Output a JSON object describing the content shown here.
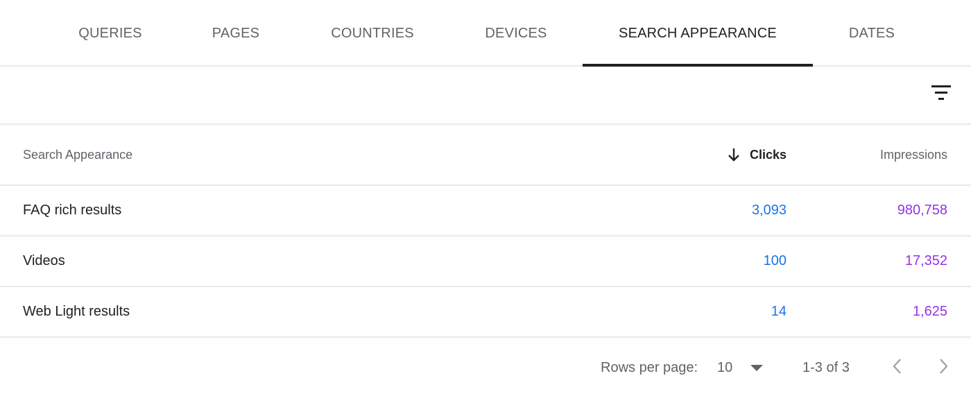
{
  "tabs": [
    {
      "label": "QUERIES",
      "active": false
    },
    {
      "label": "PAGES",
      "active": false
    },
    {
      "label": "COUNTRIES",
      "active": false
    },
    {
      "label": "DEVICES",
      "active": false
    },
    {
      "label": "SEARCH APPEARANCE",
      "active": true
    },
    {
      "label": "DATES",
      "active": false
    }
  ],
  "filter": {
    "icon": "filter-list-icon"
  },
  "table": {
    "headers": {
      "name": "Search Appearance",
      "clicks": "Clicks",
      "impressions": "Impressions",
      "sort_icon": "arrow-down-icon"
    },
    "rows": [
      {
        "name": "FAQ rich results",
        "clicks": "3,093",
        "impressions": "980,758"
      },
      {
        "name": "Videos",
        "clicks": "100",
        "impressions": "17,352"
      },
      {
        "name": "Web Light results",
        "clicks": "14",
        "impressions": "1,625"
      }
    ]
  },
  "pagination": {
    "rows_per_page_label": "Rows per page:",
    "rows_per_page_value": "10",
    "range": "1-3 of 3",
    "prev_icon": "chevron-left-icon",
    "next_icon": "chevron-right-icon"
  },
  "colors": {
    "clicks": "#1a73e8",
    "impressions": "#9334e6",
    "active_tab": "#202124"
  }
}
